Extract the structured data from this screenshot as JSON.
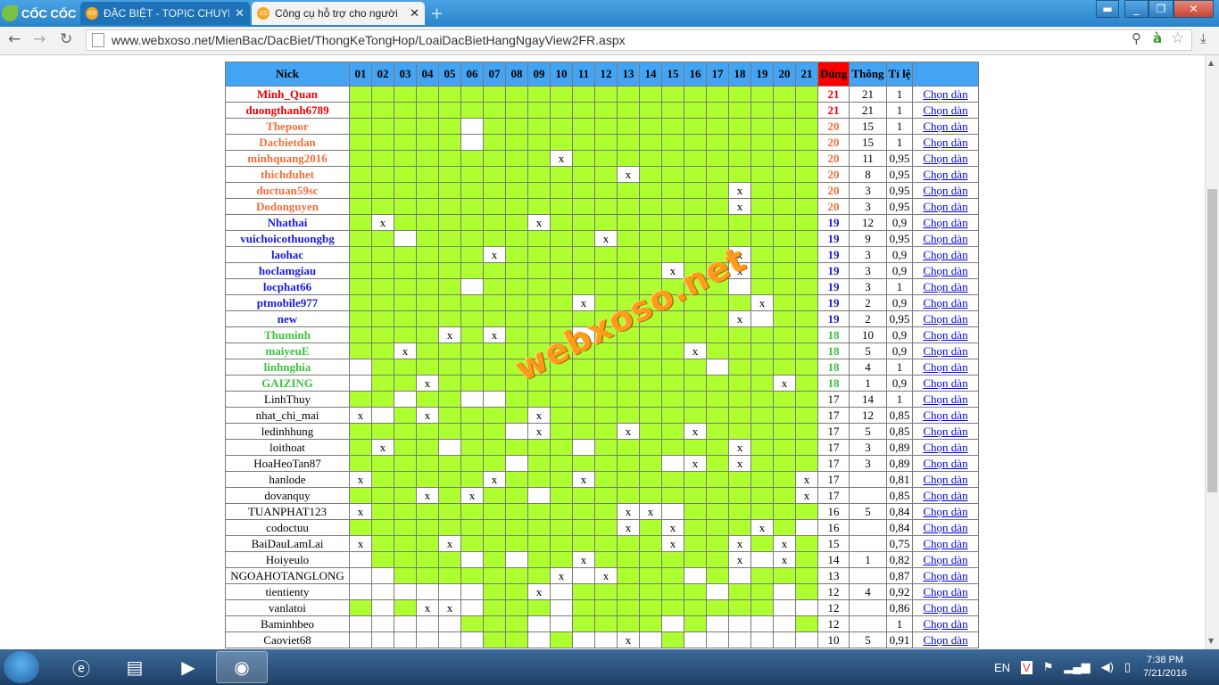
{
  "browser": {
    "logo": "CỐC CỐC",
    "tabs": [
      {
        "label": "ĐẶC BIỆT - TOPIC CHUYÊN",
        "favicon": "XS",
        "active": false
      },
      {
        "label": "Công cụ hỗ trợ cho người",
        "favicon": "XS",
        "active": true
      }
    ],
    "url": "www.webxoso.net/MienBac/DacBiet/ThongKeTongHop/LoaiDacBietHangNgayView2FR.aspx"
  },
  "table": {
    "headers": {
      "nick": "Nick",
      "dung": "Đúng",
      "thong": "Thông",
      "tile": "Tỉ lệ"
    },
    "columns": [
      "01",
      "02",
      "03",
      "04",
      "05",
      "06",
      "07",
      "08",
      "09",
      "10",
      "11",
      "12",
      "13",
      "14",
      "15",
      "16",
      "17",
      "18",
      "19",
      "20",
      "21"
    ],
    "link_label": "Chọn dàn",
    "rows": [
      {
        "nick": "Minh_Quan",
        "color": "#ee0000",
        "dung": "21",
        "thong": "21",
        "tile": "1",
        "marks": "GGGGGGGGGGGGGGGGGGGGG"
      },
      {
        "nick": "duongthanh6789",
        "color": "#ee0000",
        "dung": "21",
        "thong": "21",
        "tile": "1",
        "marks": "GGGGGGGGGGGGGGGGGGGGG"
      },
      {
        "nick": "Thepoor",
        "color": "#f0703a",
        "dung": "20",
        "thong": "15",
        "tile": "1",
        "marks": "GGGGGWGGGGGGGGGGGGGGG"
      },
      {
        "nick": "Dacbietdan",
        "color": "#f0703a",
        "dung": "20",
        "thong": "15",
        "tile": "1",
        "marks": "GGGGGWGGGGGGGGGGGGGGG"
      },
      {
        "nick": "minhquang2016",
        "color": "#f0703a",
        "dung": "20",
        "thong": "11",
        "tile": "0,95",
        "marks": "GGGGGGGGGXGGGGGGGGGGG"
      },
      {
        "nick": "thichduhet",
        "color": "#f0703a",
        "dung": "20",
        "thong": "8",
        "tile": "0,95",
        "marks": "GGGGGGGGGGGGXGGGGGGGG"
      },
      {
        "nick": "ductuan59sc",
        "color": "#f0703a",
        "dung": "20",
        "thong": "3",
        "tile": "0,95",
        "marks": "GGGGGGGGGGGGGGGGGXGGG"
      },
      {
        "nick": "Dodonguyen",
        "color": "#f0703a",
        "dung": "20",
        "thong": "3",
        "tile": "0,95",
        "marks": "GGGGGGGGGGGGGGGGGXGGG"
      },
      {
        "nick": "Nhathai",
        "color": "#1a1adf",
        "dung": "19",
        "thong": "12",
        "tile": "0,9",
        "marks": "GXGGGGGGXGGGGGGGGGGGG"
      },
      {
        "nick": "vuichoicothuongbg",
        "color": "#1a1adf",
        "dung": "19",
        "thong": "9",
        "tile": "0,95",
        "marks": "GGWGGGGGGGGXGGGGGGGGG"
      },
      {
        "nick": "laohac",
        "color": "#1a1adf",
        "dung": "19",
        "thong": "3",
        "tile": "0,9",
        "marks": "GGGGGGXGGGGGGGGGGXGGG"
      },
      {
        "nick": "hoclamgiau",
        "color": "#1a1adf",
        "dung": "19",
        "thong": "3",
        "tile": "0,9",
        "marks": "GGGGGGGGGGGGGGXGGXGGG"
      },
      {
        "nick": "locphat66",
        "color": "#1a1adf",
        "dung": "19",
        "thong": "3",
        "tile": "1",
        "marks": "GGGGGWGGGGGGGGGGGWGGG"
      },
      {
        "nick": "ptmobile977",
        "color": "#1a1adf",
        "dung": "19",
        "thong": "2",
        "tile": "0,9",
        "marks": "GGGGGGGGGGXGGGGGGGXGG"
      },
      {
        "nick": "new",
        "color": "#1a1adf",
        "dung": "19",
        "thong": "2",
        "tile": "0,95",
        "marks": "GGGGGGGGGGGGGGGGGXWGG"
      },
      {
        "nick": "Thuminh",
        "color": "#3cc43c",
        "dung": "18",
        "thong": "10",
        "tile": "0,9",
        "marks": "GGGGXGXGGGWGGGGGGGGGG"
      },
      {
        "nick": "maiyeuE",
        "color": "#3cc43c",
        "dung": "18",
        "thong": "5",
        "tile": "0,9",
        "marks": "GGXGGGGGGGGGGGGXGGGGG"
      },
      {
        "nick": "linhnghia",
        "color": "#3cc43c",
        "dung": "18",
        "thong": "4",
        "tile": "1",
        "marks": "WGGGGGGGGGGGGGGGWGGGG"
      },
      {
        "nick": "GAIZING",
        "color": "#3cc43c",
        "dung": "18",
        "thong": "1",
        "tile": "0,9",
        "marks": "WGGXGGGGGGGGGGGGGGGXG"
      },
      {
        "nick": "LinhThuy",
        "color": "#000000",
        "dung": "17",
        "thong": "14",
        "tile": "1",
        "marks": "GGWGGWWGGGGGGGGGGGGGG"
      },
      {
        "nick": "nhat_chi_mai",
        "color": "#000000",
        "dung": "17",
        "thong": "12",
        "tile": "0,85",
        "marks": "XWGXGGGGXGGGGGGGGGGGG"
      },
      {
        "nick": "ledinhhung",
        "color": "#000000",
        "dung": "17",
        "thong": "5",
        "tile": "0,85",
        "marks": "GGGGGGGWXGGGXGGXGGGGG"
      },
      {
        "nick": "loithoat",
        "color": "#000000",
        "dung": "17",
        "thong": "3",
        "tile": "0,89",
        "marks": "GXGGWGGGGGWGGGGGGXGGG"
      },
      {
        "nick": "HoaHeoTan87",
        "color": "#000000",
        "dung": "17",
        "thong": "3",
        "tile": "0,89",
        "marks": "GGGGGGGWGGGGGGWXGXGGG"
      },
      {
        "nick": "hanlode",
        "color": "#000000",
        "dung": "17",
        "thong": "",
        "tile": "0,81",
        "marks": "XGGGGGXGGGXGGGGGGGGGX"
      },
      {
        "nick": "dovanquy",
        "color": "#000000",
        "dung": "17",
        "thong": "",
        "tile": "0,85",
        "marks": "GGGXGXGGWGGGGGGGGGGGX"
      },
      {
        "nick": "TUANPHAT123",
        "color": "#000000",
        "dung": "16",
        "thong": "5",
        "tile": "0,84",
        "marks": "XGGGGGGGGGGGXXWGGGGGG"
      },
      {
        "nick": "codoctuu",
        "color": "#000000",
        "dung": "16",
        "thong": "",
        "tile": "0,84",
        "marks": "GGGGGGGGGGGGXGXGGGXGW"
      },
      {
        "nick": "BaiDauLamLai",
        "color": "#000000",
        "dung": "15",
        "thong": "",
        "tile": "0,75",
        "marks": "XGGGXGGGGGGGGGXGGXGXG"
      },
      {
        "nick": "Hoiyeulo",
        "color": "#000000",
        "dung": "14",
        "thong": "1",
        "tile": "0,82",
        "marks": "WGGGGWGWGGXGGGGGGXWXG"
      },
      {
        "nick": "NGOAHOTANGLONG",
        "color": "#000000",
        "dung": "13",
        "thong": "",
        "tile": "0,87",
        "marks": "WWGGGGGGGXWXGGGWGWGGG"
      },
      {
        "nick": "tientienty",
        "color": "#000000",
        "dung": "12",
        "thong": "4",
        "tile": "0,92",
        "marks": "WWWWWWGGXWGGGGGGWGGWG"
      },
      {
        "nick": "vanlatoi",
        "color": "#000000",
        "dung": "12",
        "thong": "",
        "tile": "0,86",
        "marks": "GWGXXWGGGWGGGGGGGGGWW"
      },
      {
        "nick": "Baminhbeo",
        "color": "#000000",
        "dung": "12",
        "thong": "",
        "tile": "1",
        "marks": "WWWWWGGGWWGGGGWGWWWWG"
      },
      {
        "nick": "Caoviet68",
        "color": "#000000",
        "dung": "10",
        "thong": "5",
        "tile": "0,91",
        "marks": "WWWWWWGGWGWWXWGWWWWWW"
      }
    ]
  },
  "watermark": "webxoso.net",
  "taskbar": {
    "lang": "EN",
    "time": "7:38 PM",
    "date": "7/21/2016"
  }
}
